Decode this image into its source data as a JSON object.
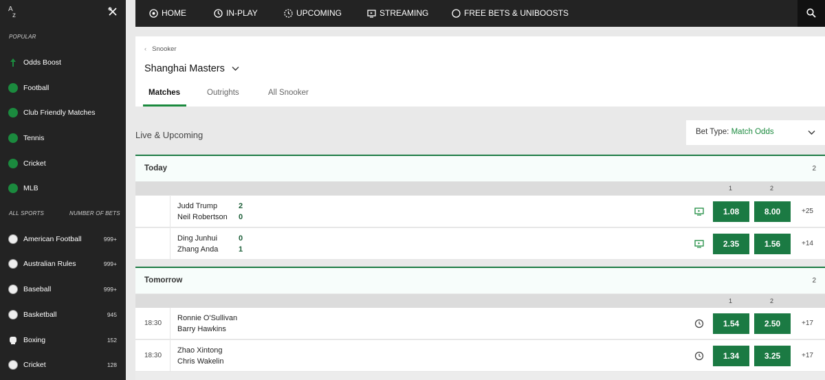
{
  "sidebar": {
    "popular_label": "POPULAR",
    "popular": [
      {
        "label": "Odds Boost",
        "icon": "odds-boost-icon"
      },
      {
        "label": "Football",
        "icon": "football-icon"
      },
      {
        "label": "Club Friendly Matches",
        "icon": "football-icon"
      },
      {
        "label": "Tennis",
        "icon": "tennis-icon"
      },
      {
        "label": "Cricket",
        "icon": "cricket-icon"
      },
      {
        "label": "MLB",
        "icon": "baseball-icon"
      }
    ],
    "all_sports_label": "ALL SPORTS",
    "number_of_bets_label": "NUMBER OF BETS",
    "sports": [
      {
        "label": "American Football",
        "count": "999+",
        "icon": "american-football-icon"
      },
      {
        "label": "Australian Rules",
        "count": "999+",
        "icon": "australian-rules-icon"
      },
      {
        "label": "Baseball",
        "count": "999+",
        "icon": "baseball-icon"
      },
      {
        "label": "Basketball",
        "count": "945",
        "icon": "basketball-icon"
      },
      {
        "label": "Boxing",
        "count": "152",
        "icon": "boxing-icon"
      },
      {
        "label": "Cricket",
        "count": "128",
        "icon": "cricket-icon"
      }
    ]
  },
  "nav": {
    "items": [
      {
        "label": "HOME",
        "icon": "home-icon"
      },
      {
        "label": "IN-PLAY",
        "icon": "clock-icon"
      },
      {
        "label": "UPCOMING",
        "icon": "refresh-clock-icon"
      },
      {
        "label": "STREAMING",
        "icon": "tv-icon"
      },
      {
        "label": "FREE BETS & UNIBOOSTS",
        "icon": "circle-icon"
      }
    ]
  },
  "header": {
    "breadcrumb": "Snooker",
    "title": "Shanghai Masters",
    "tabs": [
      "Matches",
      "Outrights",
      "All Snooker"
    ]
  },
  "section": {
    "title": "Live & Upcoming",
    "bet_type_label": "Bet Type:",
    "bet_type_value": "Match Odds"
  },
  "days": [
    {
      "label": "Today",
      "count": "2",
      "col1": "1",
      "col2": "2",
      "events": [
        {
          "time": "",
          "p1": "Judd Trump",
          "p2": "Neil Robertson",
          "s1": "2",
          "s2": "0",
          "odd1": "1.08",
          "odd2": "8.00",
          "more": "+25",
          "icon": "tv-icon"
        },
        {
          "time": "",
          "p1": "Ding Junhui",
          "p2": "Zhang Anda",
          "s1": "0",
          "s2": "1",
          "odd1": "2.35",
          "odd2": "1.56",
          "more": "+14",
          "icon": "tv-icon"
        }
      ]
    },
    {
      "label": "Tomorrow",
      "count": "2",
      "col1": "1",
      "col2": "2",
      "events": [
        {
          "time": "18:30",
          "p1": "Ronnie O'Sullivan",
          "p2": "Barry Hawkins",
          "s1": "",
          "s2": "",
          "odd1": "1.54",
          "odd2": "2.50",
          "more": "+17",
          "icon": "clock-icon"
        },
        {
          "time": "18:30",
          "p1": "Zhao Xintong",
          "p2": "Chris Wakelin",
          "s1": "",
          "s2": "",
          "odd1": "1.34",
          "odd2": "3.25",
          "more": "+17",
          "icon": "clock-icon"
        }
      ]
    }
  ],
  "colors": {
    "accent": "#1b7a43",
    "dark": "#232323"
  }
}
